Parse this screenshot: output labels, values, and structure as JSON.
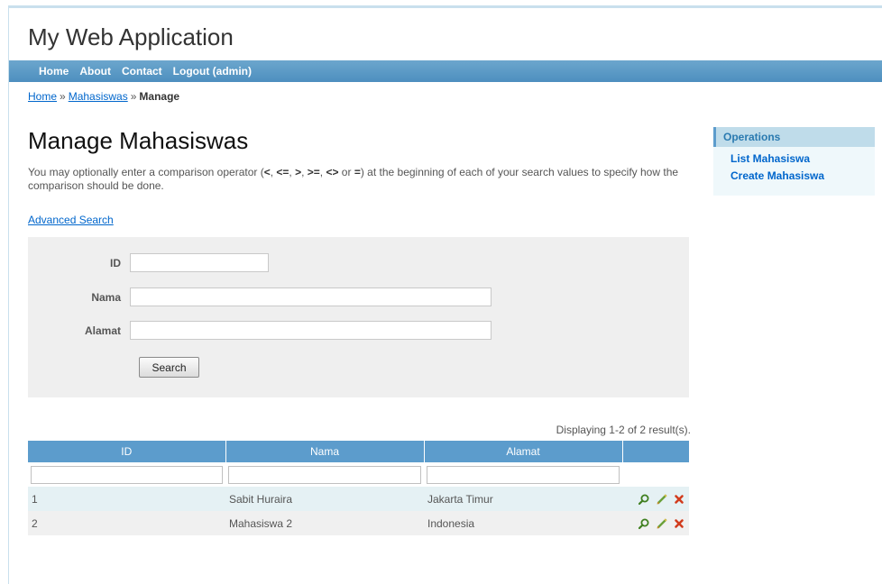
{
  "site": {
    "title": "My Web Application"
  },
  "menu": [
    {
      "label": "Home"
    },
    {
      "label": "About"
    },
    {
      "label": "Contact"
    },
    {
      "label": "Logout (admin)"
    }
  ],
  "breadcrumbs": {
    "home": "Home",
    "sep": "»",
    "section": "Mahasiswas",
    "current": "Manage"
  },
  "page": {
    "title": "Manage Mahasiswas",
    "intro_before": "You may optionally enter a comparison operator (",
    "operators": [
      "<",
      "<=",
      ">",
      ">=",
      "<>",
      "="
    ],
    "intro_after": ") at the beginning of each of your search values to specify how the comparison should be done.",
    "advanced_search": "Advanced Search"
  },
  "search_form": {
    "fields": [
      {
        "label": "ID",
        "value": ""
      },
      {
        "label": "Nama",
        "value": ""
      },
      {
        "label": "Alamat",
        "value": ""
      }
    ],
    "button": "Search"
  },
  "grid": {
    "summary": "Displaying 1-2 of 2 result(s).",
    "columns": [
      "ID",
      "Nama",
      "Alamat",
      ""
    ],
    "rows": [
      {
        "id": "1",
        "nama": "Sabit Huraira",
        "alamat": "Jakarta Timur"
      },
      {
        "id": "2",
        "nama": "Mahasiswa 2",
        "alamat": "Indonesia"
      }
    ],
    "action_icons": [
      "view-icon",
      "update-icon",
      "delete-icon"
    ]
  },
  "sidebar": {
    "title": "Operations",
    "items": [
      {
        "label": "List Mahasiswa"
      },
      {
        "label": "Create Mahasiswa"
      }
    ]
  },
  "colors": {
    "menu_bar": "#5c9ccc",
    "grid_header": "#5c9ccc",
    "row_odd": "#e5f1f4",
    "row_even": "#f0f0f0",
    "link": "#0066cc",
    "delete_icon": "#d23c1e",
    "update_icon": "#6aa03a"
  }
}
